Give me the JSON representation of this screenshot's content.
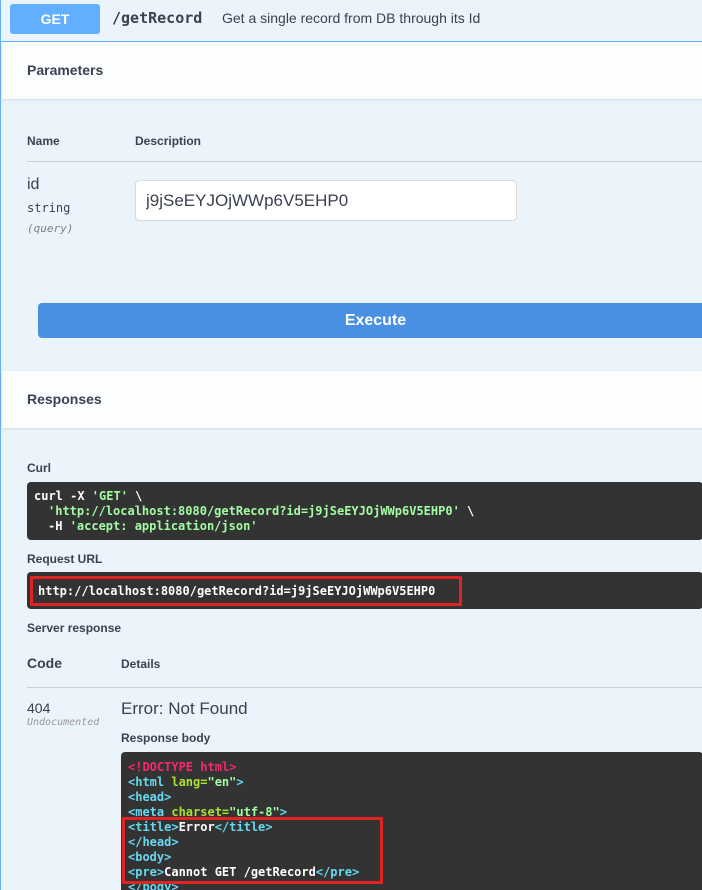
{
  "summary": {
    "method": "GET",
    "path": "/getRecord",
    "description": "Get a single record from DB through its Id"
  },
  "parameters": {
    "title": "Parameters",
    "col_name": "Name",
    "col_description": "Description",
    "param": {
      "name": "id",
      "type": "string",
      "in": "(query)",
      "value": "j9jSeEYJOjWWp6V5EHP0"
    },
    "execute_label": "Execute"
  },
  "responses": {
    "title": "Responses",
    "curl_label": "Curl",
    "curl": {
      "line1_cmd": "curl -X ",
      "line1_method": "'GET'",
      "line1_tail": " \\",
      "line2_url": "'http://localhost:8080/getRecord?id=j9jSeEYJOjWWp6V5EHP0'",
      "line2_tail": " \\",
      "line3_flag": "-H ",
      "line3_header": "'accept: application/json'"
    },
    "request_url_label": "Request URL",
    "request_url": "http://localhost:8080/getRecord?id=j9jSeEYJOjWWp6V5EHP0",
    "server_response_label": "Server response",
    "code_col": "Code",
    "details_col": "Details",
    "status_code": "404",
    "status_note": "Undocumented",
    "error_title": "Error: Not Found",
    "response_body_label": "Response body",
    "body": {
      "l1": "<!DOCTYPE html>",
      "l2_open": "<html ",
      "l2_attr": "lang=",
      "l2_val": "\"en\"",
      "l2_close": ">",
      "l3": "<head>",
      "l4_open": "<meta ",
      "l4_attr": "charset=",
      "l4_val": "\"utf-8\"",
      "l4_close": ">",
      "l5_open": "<title>",
      "l5_text": "Error",
      "l5_close": "</title>",
      "l6": "</head>",
      "l7": "<body>",
      "l8_open": "<pre>",
      "l8_text": "Cannot GET /getRecord",
      "l8_close": "</pre>",
      "l9": "</body>"
    }
  }
}
